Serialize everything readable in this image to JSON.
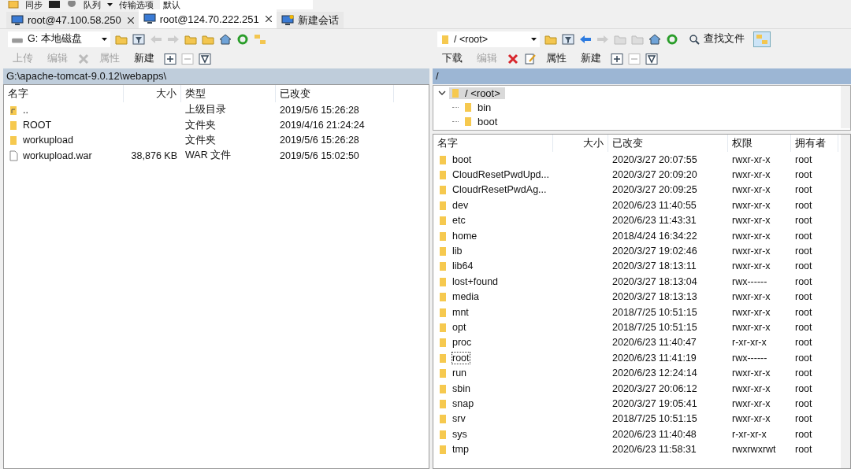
{
  "top_toolbar": {
    "sync": "同步",
    "queue": "队列",
    "transfer_label": "传输选项",
    "transfer_value": "默认"
  },
  "tabs": [
    {
      "label": "root@47.100.58.250",
      "selected": false,
      "kind": "session"
    },
    {
      "label": "root@124.70.222.251",
      "selected": true,
      "kind": "session"
    },
    {
      "label": "新建会话",
      "selected": false,
      "kind": "new"
    }
  ],
  "left_panel": {
    "drive": "G: 本地磁盘",
    "actions": [
      {
        "label": "上传",
        "disabled": true
      },
      {
        "label": "编辑",
        "disabled": true
      },
      {
        "label": "属性",
        "disabled": true
      },
      {
        "label": "新建",
        "disabled": false
      }
    ],
    "path": "G:\\apache-tomcat-9.0.12\\webapps\\",
    "columns": [
      "名字",
      "大小",
      "类型",
      "已改变"
    ],
    "rows": [
      {
        "kind": "up",
        "name": "..",
        "size": "",
        "type": "上级目录",
        "modified": "2019/5/6  15:26:28"
      },
      {
        "kind": "folder",
        "name": "ROOT",
        "size": "",
        "type": "文件夹",
        "modified": "2019/4/16  21:24:24"
      },
      {
        "kind": "folder",
        "name": "workupload",
        "size": "",
        "type": "文件夹",
        "modified": "2019/5/6  15:26:28"
      },
      {
        "kind": "file",
        "name": "workupload.war",
        "size": "38,876 KB",
        "type": "WAR 文件",
        "modified": "2019/5/6  15:02:50"
      }
    ]
  },
  "right_panel": {
    "location": "/ <root>",
    "find": "查找文件",
    "actions": [
      {
        "label": "下载",
        "disabled": false
      },
      {
        "label": "编辑",
        "disabled": true
      },
      {
        "label": "属性",
        "disabled": false
      },
      {
        "label": "新建",
        "disabled": false
      }
    ],
    "path": "/",
    "tree": {
      "label": "/ <root>",
      "expanded": true,
      "selected": true,
      "children": [
        {
          "label": "bin"
        },
        {
          "label": "boot"
        }
      ]
    },
    "columns": [
      "名字",
      "大小",
      "已改变",
      "权限",
      "拥有者"
    ],
    "rows": [
      {
        "name": "boot",
        "modified": "2020/3/27 20:07:55",
        "rights": "rwxr-xr-x",
        "owner": "root",
        "focused": false
      },
      {
        "name": "CloudResetPwdUpd...",
        "modified": "2020/3/27 20:09:20",
        "rights": "rwxr-xr-x",
        "owner": "root",
        "focused": false
      },
      {
        "name": "CloudrResetPwdAg...",
        "modified": "2020/3/27 20:09:25",
        "rights": "rwxr-xr-x",
        "owner": "root",
        "focused": false
      },
      {
        "name": "dev",
        "modified": "2020/6/23 11:40:55",
        "rights": "rwxr-xr-x",
        "owner": "root",
        "focused": false
      },
      {
        "name": "etc",
        "modified": "2020/6/23 11:43:31",
        "rights": "rwxr-xr-x",
        "owner": "root",
        "focused": false
      },
      {
        "name": "home",
        "modified": "2018/4/24 16:34:22",
        "rights": "rwxr-xr-x",
        "owner": "root",
        "focused": false
      },
      {
        "name": "lib",
        "modified": "2020/3/27 19:02:46",
        "rights": "rwxr-xr-x",
        "owner": "root",
        "focused": false
      },
      {
        "name": "lib64",
        "modified": "2020/3/27 18:13:11",
        "rights": "rwxr-xr-x",
        "owner": "root",
        "focused": false
      },
      {
        "name": "lost+found",
        "modified": "2020/3/27 18:13:04",
        "rights": "rwx------",
        "owner": "root",
        "focused": false
      },
      {
        "name": "media",
        "modified": "2020/3/27 18:13:13",
        "rights": "rwxr-xr-x",
        "owner": "root",
        "focused": false
      },
      {
        "name": "mnt",
        "modified": "2018/7/25 10:51:15",
        "rights": "rwxr-xr-x",
        "owner": "root",
        "focused": false
      },
      {
        "name": "opt",
        "modified": "2018/7/25 10:51:15",
        "rights": "rwxr-xr-x",
        "owner": "root",
        "focused": false
      },
      {
        "name": "proc",
        "modified": "2020/6/23 11:40:47",
        "rights": "r-xr-xr-x",
        "owner": "root",
        "focused": false
      },
      {
        "name": "root",
        "modified": "2020/6/23 11:41:19",
        "rights": "rwx------",
        "owner": "root",
        "focused": true
      },
      {
        "name": "run",
        "modified": "2020/6/23 12:24:14",
        "rights": "rwxr-xr-x",
        "owner": "root",
        "focused": false
      },
      {
        "name": "sbin",
        "modified": "2020/3/27 20:06:12",
        "rights": "rwxr-xr-x",
        "owner": "root",
        "focused": false
      },
      {
        "name": "snap",
        "modified": "2020/3/27 19:05:41",
        "rights": "rwxr-xr-x",
        "owner": "root",
        "focused": false
      },
      {
        "name": "srv",
        "modified": "2018/7/25 10:51:15",
        "rights": "rwxr-xr-x",
        "owner": "root",
        "focused": false
      },
      {
        "name": "sys",
        "modified": "2020/6/23 11:40:48",
        "rights": "r-xr-xr-x",
        "owner": "root",
        "focused": false
      },
      {
        "name": "tmp",
        "modified": "2020/6/23 11:58:31",
        "rights": "rwxrwxrwt",
        "owner": "root",
        "focused": false
      }
    ]
  }
}
